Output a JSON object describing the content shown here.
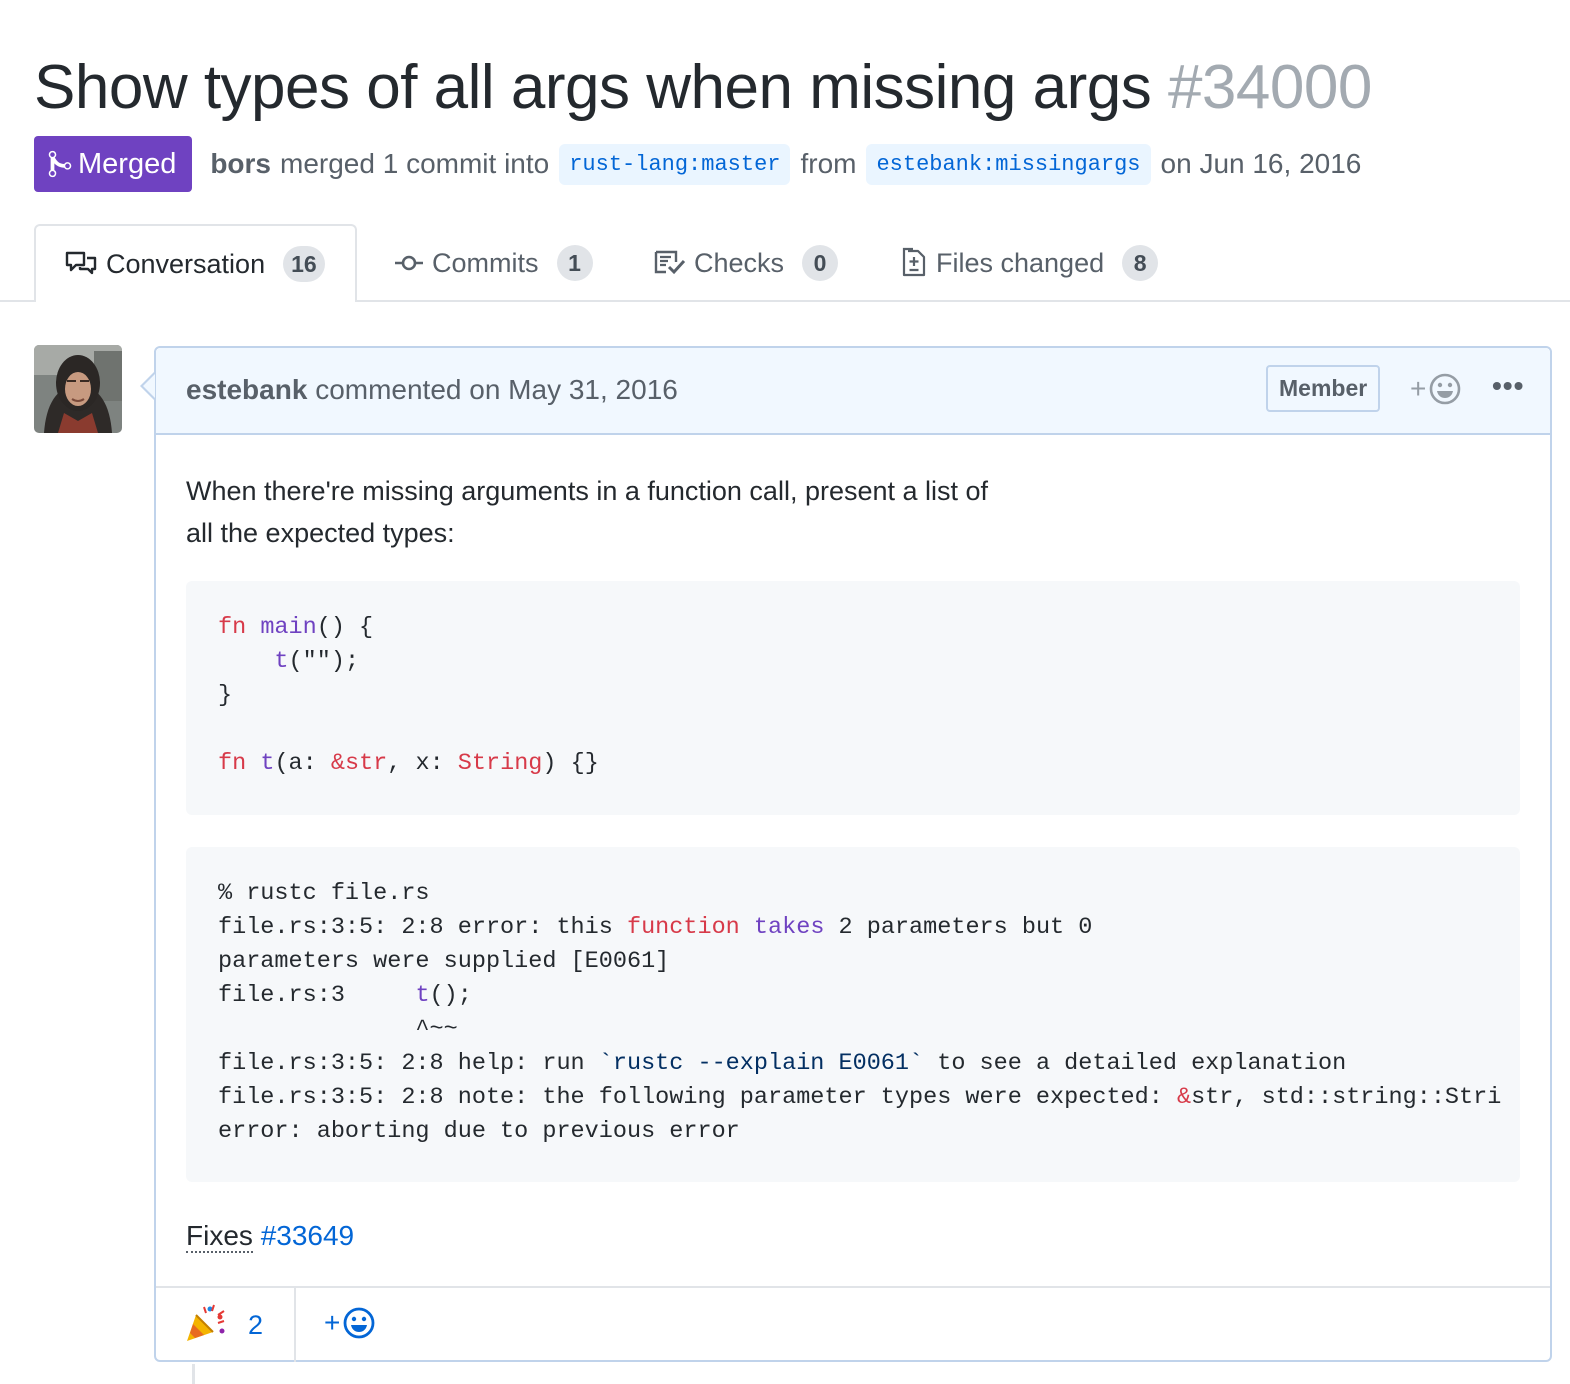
{
  "pr": {
    "title": "Show types of all args when missing args",
    "number": "#34000",
    "state": "Merged",
    "merger": "bors",
    "merged_text": "merged 1 commit into",
    "base_branch": "rust-lang:master",
    "from_text": "from",
    "head_branch": "estebank:missingargs",
    "date_text": "on Jun 16, 2016"
  },
  "tabs": [
    {
      "label": "Conversation",
      "count": "16",
      "icon": "comment-discussion-icon"
    },
    {
      "label": "Commits",
      "count": "1",
      "icon": "git-commit-icon"
    },
    {
      "label": "Checks",
      "count": "0",
      "icon": "checklist-icon"
    },
    {
      "label": "Files changed",
      "count": "8",
      "icon": "diff-icon"
    }
  ],
  "comment": {
    "author": "estebank",
    "action": "commented on May 31, 2016",
    "role": "Member",
    "add_reaction": "+",
    "menu": "•••",
    "body_line1": "When there're missing arguments in a function call, present a list of",
    "body_line2": "all the expected types:",
    "fixes_word": "Fixes",
    "fixes_link": "#33649",
    "reactions": [
      {
        "emoji": "🎉",
        "count": "2"
      }
    ]
  },
  "code_block_1": {
    "l1_kw": "fn",
    "l1_fn": "main",
    "l1_rest": "() {",
    "l2_fn": "t",
    "l2_rest": "(\"\");",
    "l3": "}",
    "l5_kw": "fn",
    "l5_fn": "t",
    "l5_a": "(a: ",
    "l5_t1": "&str",
    "l5_b": ", x: ",
    "l5_t2": "String",
    "l5_c": ") {}"
  },
  "code_block_2": {
    "l1": "% rustc file.rs",
    "l2_a": "file.rs:3:5: 2:8 error: this ",
    "l2_kw": "function",
    "l2_sp": " ",
    "l2_fn": "takes",
    "l2_b": " 2 parameters but 0",
    "l3": "parameters were supplied [E0061]",
    "l4_a": "file.rs:3     ",
    "l4_fn": "t",
    "l4_b": "();",
    "l5": "              ^~~",
    "l6_a": "file.rs:3:5: 2:8 help: run ",
    "l6_s": "`rustc --explain E0061`",
    "l6_b": " to see a detailed explanation",
    "l7_a": "file.rs:3:5: 2:8 note: the following parameter types were expected: ",
    "l7_k": "&",
    "l7_b": "str, std::string::Stri",
    "l8": "error: aborting due to previous error"
  },
  "colors": {
    "merged": "#6f42c1",
    "link": "#0366d6",
    "header_bg": "#f1f8ff",
    "code_bg": "#f6f8fa",
    "keyword": "#d73a49",
    "function": "#6f42c1"
  }
}
